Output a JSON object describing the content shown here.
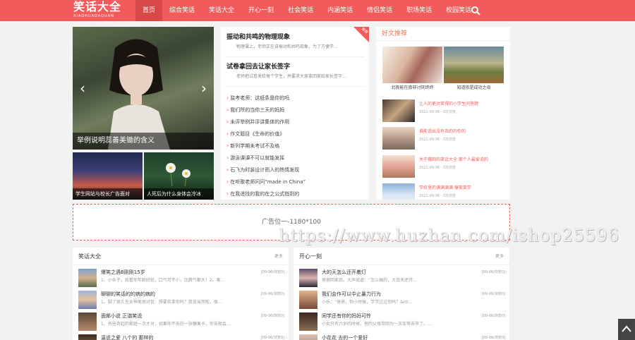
{
  "brand": {
    "name": "笑话大全",
    "pinyin": "XIAOHUADAQUAN"
  },
  "nav": [
    "首页",
    "综合笑话",
    "笑话大全",
    "开心一刻",
    "社会笑话",
    "内涵笑话",
    "情侣笑话",
    "职场笑话",
    "校园笑话"
  ],
  "slider": {
    "caption": "举例说明蕊善美锄的含义"
  },
  "thumbs": [
    {
      "caption": "学生网站与校长广告面对"
    },
    {
      "caption": "人死后为什么身体会冷冰"
    }
  ],
  "headlines": [
    {
      "title": "振动和共鸣的物理现象",
      "desc": "物理课上，老师正在讲振动和共鸣现象，为了方便学…"
    },
    {
      "title": "试卷拿回去让家长签字",
      "desc": "老师把试卷发给每个学生，并要求大家拿回家给家长签字…"
    }
  ],
  "ribbon": "推荐",
  "center_list": [
    "监考老师：这纸条是你的吗",
    "我们所的当你三天的妈妈",
    "未评举例并评讲集体的作用",
    "作文题目《生命的价值》",
    "新列学期未考试不及格",
    "游泳课课不可以就能发挥",
    "石飞为时装设计而人的热情发现",
    "在听歌老师问问“made in China”",
    "在我进找的我的在之公式指到的"
  ],
  "recommend": {
    "header": "好文推荐",
    "pics": [
      {
        "caption": "北极能在南非讨厌终终"
      },
      {
        "caption": "知道依是成功之母"
      }
    ],
    "items": [
      {
        "title": "让人的更对笑得的小学生问答题",
        "meta": "2021-09-06 · 0次浏览"
      },
      {
        "title": "谁能说出没有去的的你的",
        "meta": "2021-09-06 · 0次浏览"
      },
      {
        "title": "关于做回的笑话大全 那个人最爱说的",
        "meta": "2021-09-06 · 0次浏览"
      },
      {
        "title": "学校里的满满满满 爆笑笑学",
        "meta": "2021-09-06 · 0次浏览"
      }
    ]
  },
  "ad": {
    "label": "广告位一-1180*100"
  },
  "watermark": "https://www.huzhan.com/ishop25596",
  "panels": [
    {
      "title": "笑话大全",
      "more": "更多",
      "rows": [
        {
          "title": "爆笑之遇B刚刚15岁",
          "date": "[09-06/浏览0]",
          "desc": "1、小伙子，我看你年龄好轻，口气可不小，比脾气都大！2、客…"
        },
        {
          "title": "聊聊的笑话的的病的病的",
          "date": "[09-06/浏览0]",
          "desc": "1、脚了很久先女神美丽对我：想要我拿你吗？我说当然啦。很…"
        },
        {
          "title": "面邮小说 正谐笑说",
          "date": "[09-06/浏览0]",
          "desc": "1、有些奇起的家庭一次才对，如果你不去的一张糖果卡，你去就会…"
        },
        {
          "title": "温说之爱 八个的 那样的",
          "date": "[09-06/浏览0]",
          "desc": ""
        }
      ]
    },
    {
      "title": "开心一刻",
      "more": "更多",
      "rows": [
        {
          "title": "大的天怎么还开着灯",
          "date": "[09-06/浏览0]",
          "desc": "爸爸回家后，大声说道：“怎么搞的，大白天还开…"
        },
        {
          "title": "我们会作可以中止暴力行为",
          "date": "[09-06/浏览0]",
          "desc": "小乐：“爸爸，你小时候，学学过过你吗？&rd…"
        },
        {
          "title": "同学还有你的妈妈可怜",
          "date": "[09-06/浏览0]",
          "desc": "小女只有六岁的时候，他的父母带回为一次车等去市了。…"
        },
        {
          "title": "小花花 去的一个爱好",
          "date": "[09-06/浏览0]",
          "desc": ""
        }
      ]
    }
  ]
}
